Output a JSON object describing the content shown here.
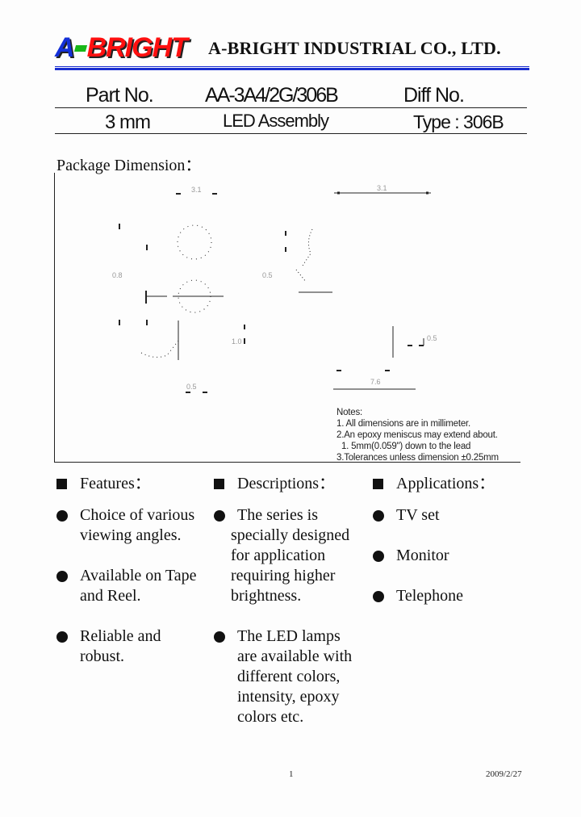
{
  "header": {
    "logo_part1": "A",
    "logo_part2": "BRIGHT",
    "company": "A-BRIGHT INDUSTRIAL CO., LTD.",
    "brand_colors": {
      "blue": "#1a2fd0",
      "red": "#ff1010",
      "green": "#18b818"
    }
  },
  "spec_table": {
    "part_no_label": "Part No.",
    "part_no_value": "AA-3A4/2G/306B",
    "diff_no_label": "Diff No.",
    "size": "3 mm",
    "product": "LED Assembly",
    "type": "Type : 306B"
  },
  "package": {
    "title": "Package Dimension：",
    "dimension_labels": [
      "3.1",
      "0.5",
      "1.0",
      "7.6",
      "0.8",
      "1.0"
    ],
    "notes": [
      "Notes:",
      "1. All dimensions are in millimeter.",
      "2.An epoxy meniscus may extend about.",
      "  1. 5mm(0.059\") down to the lead",
      "3.Tolerances unless dimension ±0.25mm"
    ]
  },
  "sections": {
    "features": {
      "title": "Features：",
      "items": [
        "Choice of various\nviewing angles.",
        "Available on Tape\nand Reel.",
        "Reliable and\nrobust."
      ]
    },
    "descriptions": {
      "title": "Descriptions：",
      "items": [
        " The series is",
        "The LED lamps\nare available with\ndifferent colors,\nintensity, epoxy\ncolors etc."
      ],
      "item0_continuation": "specially designed\nfor application\nrequiring higher\nbrightness."
    },
    "applications": {
      "title": "Applications：",
      "items": [
        "TV set",
        "Monitor",
        "Telephone"
      ]
    }
  },
  "footer": {
    "page_number": "1",
    "date": "2009/2/27"
  }
}
